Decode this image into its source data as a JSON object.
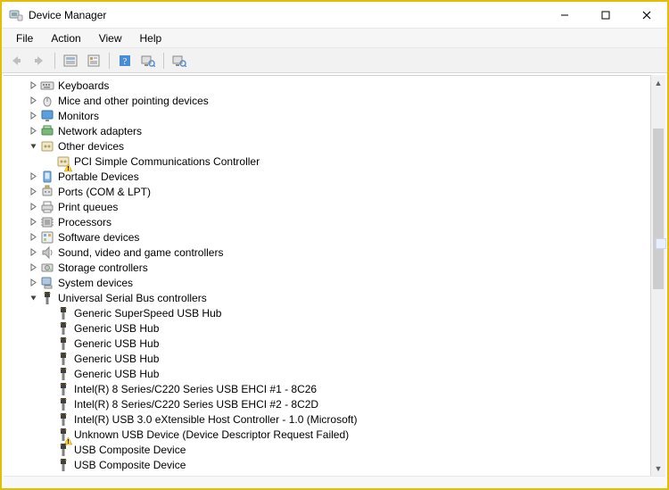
{
  "window": {
    "title": "Device Manager"
  },
  "menu": {
    "file": "File",
    "action": "Action",
    "view": "View",
    "help": "Help"
  },
  "tree": {
    "nodes": [
      {
        "depth": 1,
        "expand": "closed",
        "icon": "keyboard",
        "warn": false,
        "label": "Keyboards"
      },
      {
        "depth": 1,
        "expand": "closed",
        "icon": "mouse",
        "warn": false,
        "label": "Mice and other pointing devices"
      },
      {
        "depth": 1,
        "expand": "closed",
        "icon": "monitor",
        "warn": false,
        "label": "Monitors"
      },
      {
        "depth": 1,
        "expand": "closed",
        "icon": "network",
        "warn": false,
        "label": "Network adapters"
      },
      {
        "depth": 1,
        "expand": "open",
        "icon": "other",
        "warn": false,
        "label": "Other devices"
      },
      {
        "depth": 2,
        "expand": "none",
        "icon": "other",
        "warn": true,
        "label": "PCI Simple Communications Controller"
      },
      {
        "depth": 1,
        "expand": "closed",
        "icon": "portable",
        "warn": false,
        "label": "Portable Devices"
      },
      {
        "depth": 1,
        "expand": "closed",
        "icon": "ports",
        "warn": false,
        "label": "Ports (COM & LPT)"
      },
      {
        "depth": 1,
        "expand": "closed",
        "icon": "printer",
        "warn": false,
        "label": "Print queues"
      },
      {
        "depth": 1,
        "expand": "closed",
        "icon": "processor",
        "warn": false,
        "label": "Processors"
      },
      {
        "depth": 1,
        "expand": "closed",
        "icon": "software",
        "warn": false,
        "label": "Software devices"
      },
      {
        "depth": 1,
        "expand": "closed",
        "icon": "sound",
        "warn": false,
        "label": "Sound, video and game controllers"
      },
      {
        "depth": 1,
        "expand": "closed",
        "icon": "storage",
        "warn": false,
        "label": "Storage controllers"
      },
      {
        "depth": 1,
        "expand": "closed",
        "icon": "system",
        "warn": false,
        "label": "System devices"
      },
      {
        "depth": 1,
        "expand": "open",
        "icon": "usb-ctrl",
        "warn": false,
        "label": "Universal Serial Bus controllers"
      },
      {
        "depth": 2,
        "expand": "none",
        "icon": "usb",
        "warn": false,
        "label": "Generic SuperSpeed USB Hub"
      },
      {
        "depth": 2,
        "expand": "none",
        "icon": "usb",
        "warn": false,
        "label": "Generic USB Hub"
      },
      {
        "depth": 2,
        "expand": "none",
        "icon": "usb",
        "warn": false,
        "label": "Generic USB Hub"
      },
      {
        "depth": 2,
        "expand": "none",
        "icon": "usb",
        "warn": false,
        "label": "Generic USB Hub"
      },
      {
        "depth": 2,
        "expand": "none",
        "icon": "usb",
        "warn": false,
        "label": "Generic USB Hub"
      },
      {
        "depth": 2,
        "expand": "none",
        "icon": "usb",
        "warn": false,
        "label": "Intel(R) 8 Series/C220 Series  USB EHCI #1 - 8C26"
      },
      {
        "depth": 2,
        "expand": "none",
        "icon": "usb",
        "warn": false,
        "label": "Intel(R) 8 Series/C220 Series  USB EHCI #2 - 8C2D"
      },
      {
        "depth": 2,
        "expand": "none",
        "icon": "usb",
        "warn": false,
        "label": "Intel(R) USB 3.0 eXtensible Host Controller - 1.0 (Microsoft)"
      },
      {
        "depth": 2,
        "expand": "none",
        "icon": "usb",
        "warn": true,
        "label": "Unknown USB Device (Device Descriptor Request Failed)"
      },
      {
        "depth": 2,
        "expand": "none",
        "icon": "usb",
        "warn": false,
        "label": "USB Composite Device"
      },
      {
        "depth": 2,
        "expand": "none",
        "icon": "usb",
        "warn": false,
        "label": "USB Composite Device"
      }
    ]
  }
}
